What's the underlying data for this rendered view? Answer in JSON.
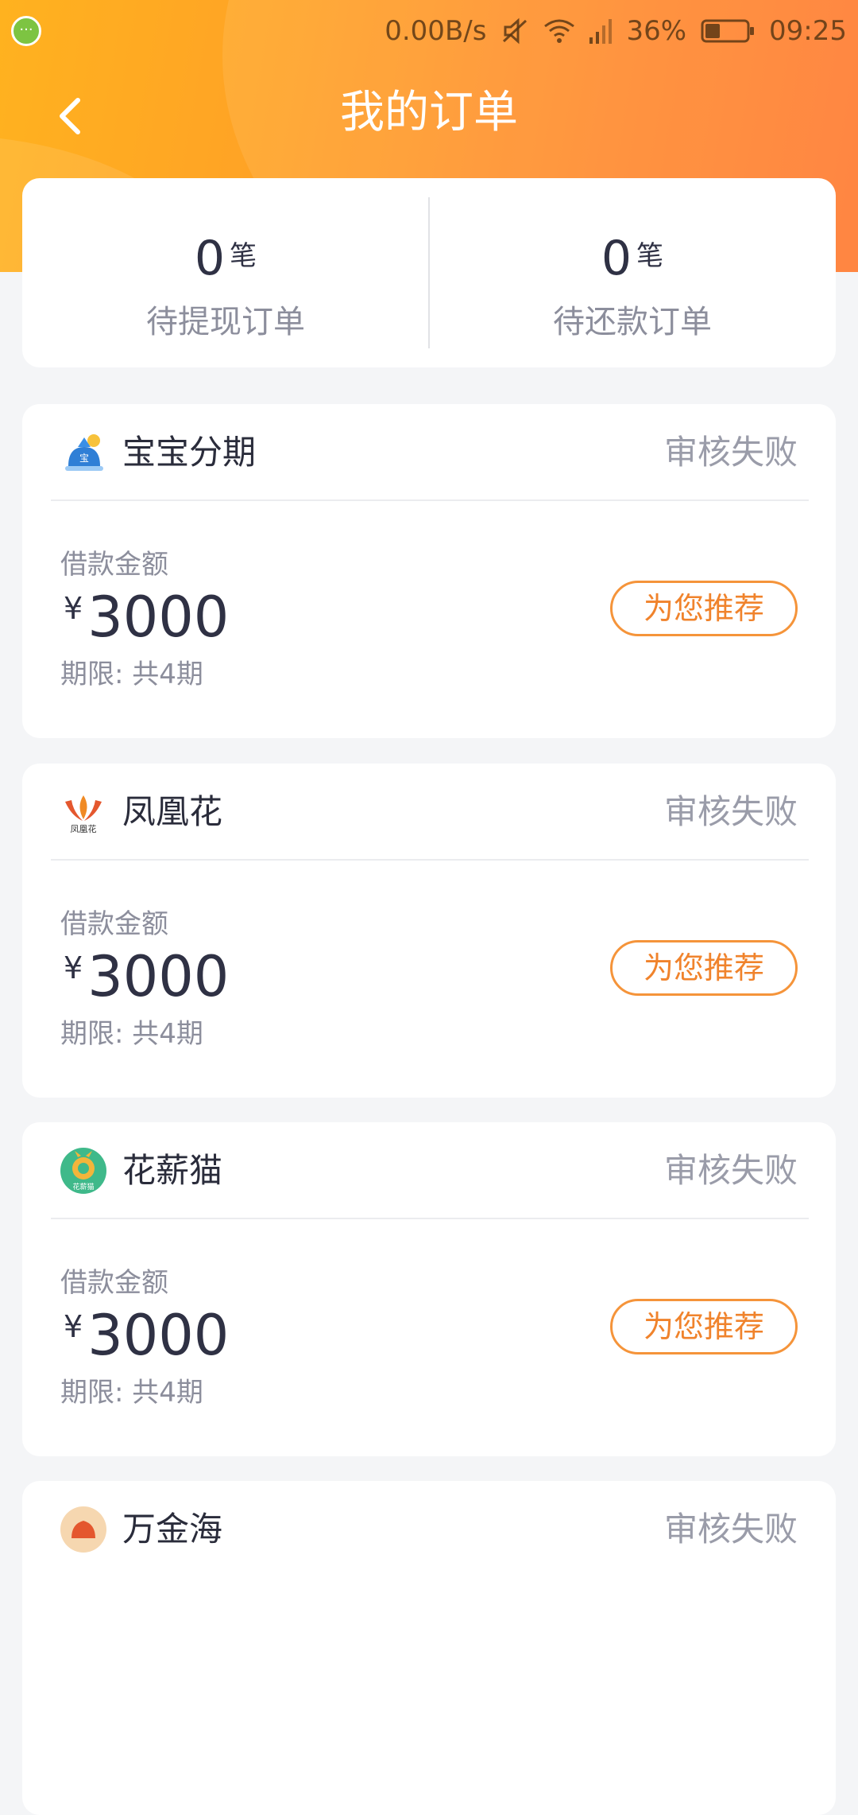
{
  "status_bar": {
    "network_speed": "0.00B/s",
    "battery_percent": "36%",
    "battery_level": 0.36,
    "time": "09:25"
  },
  "nav": {
    "title": "我的订单"
  },
  "summary": {
    "items": [
      {
        "count": "0",
        "unit": "笔",
        "label": "待提现订单"
      },
      {
        "count": "0",
        "unit": "笔",
        "label": "待还款订单"
      }
    ]
  },
  "orders": [
    {
      "name": "宝宝分期",
      "status": "审核失败",
      "amount_label": "借款金额",
      "currency": "¥",
      "amount": "3000",
      "term": "期限: 共4期",
      "button_label": "为您推荐",
      "logo_icon": "baobao-logo-icon"
    },
    {
      "name": "凤凰花",
      "status": "审核失败",
      "amount_label": "借款金额",
      "currency": "¥",
      "amount": "3000",
      "term": "期限: 共4期",
      "button_label": "为您推荐",
      "logo_icon": "phoenix-logo-icon"
    },
    {
      "name": "花薪猫",
      "status": "审核失败",
      "amount_label": "借款金额",
      "currency": "¥",
      "amount": "3000",
      "term": "期限: 共4期",
      "button_label": "为您推荐",
      "logo_icon": "cat-logo-icon"
    },
    {
      "name": "万金海",
      "status": "审核失败",
      "logo_icon": "wanjinhai-logo-icon"
    }
  ],
  "colors": {
    "header_gradient_start": "#ffb21f",
    "header_gradient_end": "#ff7a30",
    "accent_orange": "#f0832c",
    "primary_text": "#2f3144",
    "secondary_text": "#8c8e9c",
    "page_background": "#f4f5f7"
  }
}
